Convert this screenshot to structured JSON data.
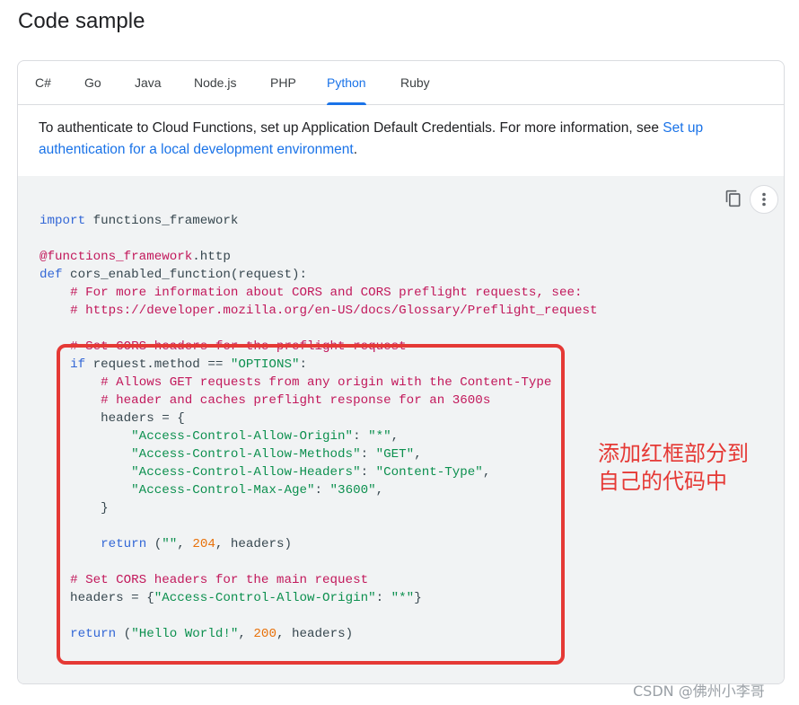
{
  "page_title": "Code sample",
  "tabs": [
    {
      "label": "C#"
    },
    {
      "label": "Go"
    },
    {
      "label": "Java"
    },
    {
      "label": "Node.js"
    },
    {
      "label": "PHP"
    },
    {
      "label": "Python",
      "active": true
    },
    {
      "label": "Ruby"
    }
  ],
  "intro": {
    "text": "To authenticate to Cloud Functions, set up Application Default Credentials. For more information, see ",
    "link": "Set up authentication for a local development environment",
    "end": "."
  },
  "code_lines": [
    [
      [
        "kw",
        "import"
      ],
      [
        "p",
        " functions_framework"
      ]
    ],
    [],
    [
      [
        "dec",
        "@functions_framework"
      ],
      [
        "p",
        ".http"
      ]
    ],
    [
      [
        "kw",
        "def"
      ],
      [
        "p",
        " cors_enabled_function(request):"
      ]
    ],
    [
      [
        "p",
        "    "
      ],
      [
        "cm",
        "# For more information about CORS and CORS preflight requests, see:"
      ]
    ],
    [
      [
        "p",
        "    "
      ],
      [
        "cm",
        "# https://developer.mozilla.org/en-US/docs/Glossary/Preflight_request"
      ]
    ],
    [],
    [
      [
        "p",
        "    "
      ],
      [
        "cm",
        "# Set CORS headers for the preflight request"
      ]
    ],
    [
      [
        "p",
        "    "
      ],
      [
        "kw",
        "if"
      ],
      [
        "p",
        " request.method == "
      ],
      [
        "str",
        "\"OPTIONS\""
      ],
      [
        "p",
        ":"
      ]
    ],
    [
      [
        "p",
        "        "
      ],
      [
        "cm",
        "# Allows GET requests from any origin with the Content-Type"
      ]
    ],
    [
      [
        "p",
        "        "
      ],
      [
        "cm",
        "# header and caches preflight response for an 3600s"
      ]
    ],
    [
      [
        "p",
        "        headers = {"
      ]
    ],
    [
      [
        "p",
        "            "
      ],
      [
        "str",
        "\"Access-Control-Allow-Origin\""
      ],
      [
        "p",
        ": "
      ],
      [
        "str",
        "\"*\""
      ],
      [
        "p",
        ","
      ]
    ],
    [
      [
        "p",
        "            "
      ],
      [
        "str",
        "\"Access-Control-Allow-Methods\""
      ],
      [
        "p",
        ": "
      ],
      [
        "str",
        "\"GET\""
      ],
      [
        "p",
        ","
      ]
    ],
    [
      [
        "p",
        "            "
      ],
      [
        "str",
        "\"Access-Control-Allow-Headers\""
      ],
      [
        "p",
        ": "
      ],
      [
        "str",
        "\"Content-Type\""
      ],
      [
        "p",
        ","
      ]
    ],
    [
      [
        "p",
        "            "
      ],
      [
        "str",
        "\"Access-Control-Max-Age\""
      ],
      [
        "p",
        ": "
      ],
      [
        "str",
        "\"3600\""
      ],
      [
        "p",
        ","
      ]
    ],
    [
      [
        "p",
        "        }"
      ]
    ],
    [],
    [
      [
        "p",
        "        "
      ],
      [
        "kw",
        "return"
      ],
      [
        "p",
        " ("
      ],
      [
        "str",
        "\"\""
      ],
      [
        "p",
        ", "
      ],
      [
        "num",
        "204"
      ],
      [
        "p",
        ", headers)"
      ]
    ],
    [],
    [
      [
        "p",
        "    "
      ],
      [
        "cm",
        "# Set CORS headers for the main request"
      ]
    ],
    [
      [
        "p",
        "    headers = {"
      ],
      [
        "str",
        "\"Access-Control-Allow-Origin\""
      ],
      [
        "p",
        ": "
      ],
      [
        "str",
        "\"*\""
      ],
      [
        "p",
        "}"
      ]
    ],
    [],
    [
      [
        "p",
        "    "
      ],
      [
        "kw",
        "return"
      ],
      [
        "p",
        " ("
      ],
      [
        "str",
        "\"Hello World!\""
      ],
      [
        "p",
        ", "
      ],
      [
        "num",
        "200"
      ],
      [
        "p",
        ", headers)"
      ]
    ]
  ],
  "annotation": {
    "line1": "添加红框部分到",
    "line2": "自己的代码中"
  },
  "watermark": "CSDN @佛州小李哥",
  "icons": {
    "copy": "copy-icon",
    "more": "more-vert-icon"
  },
  "colors": {
    "accent": "#1a73e8",
    "highlight_box": "#e53935"
  }
}
